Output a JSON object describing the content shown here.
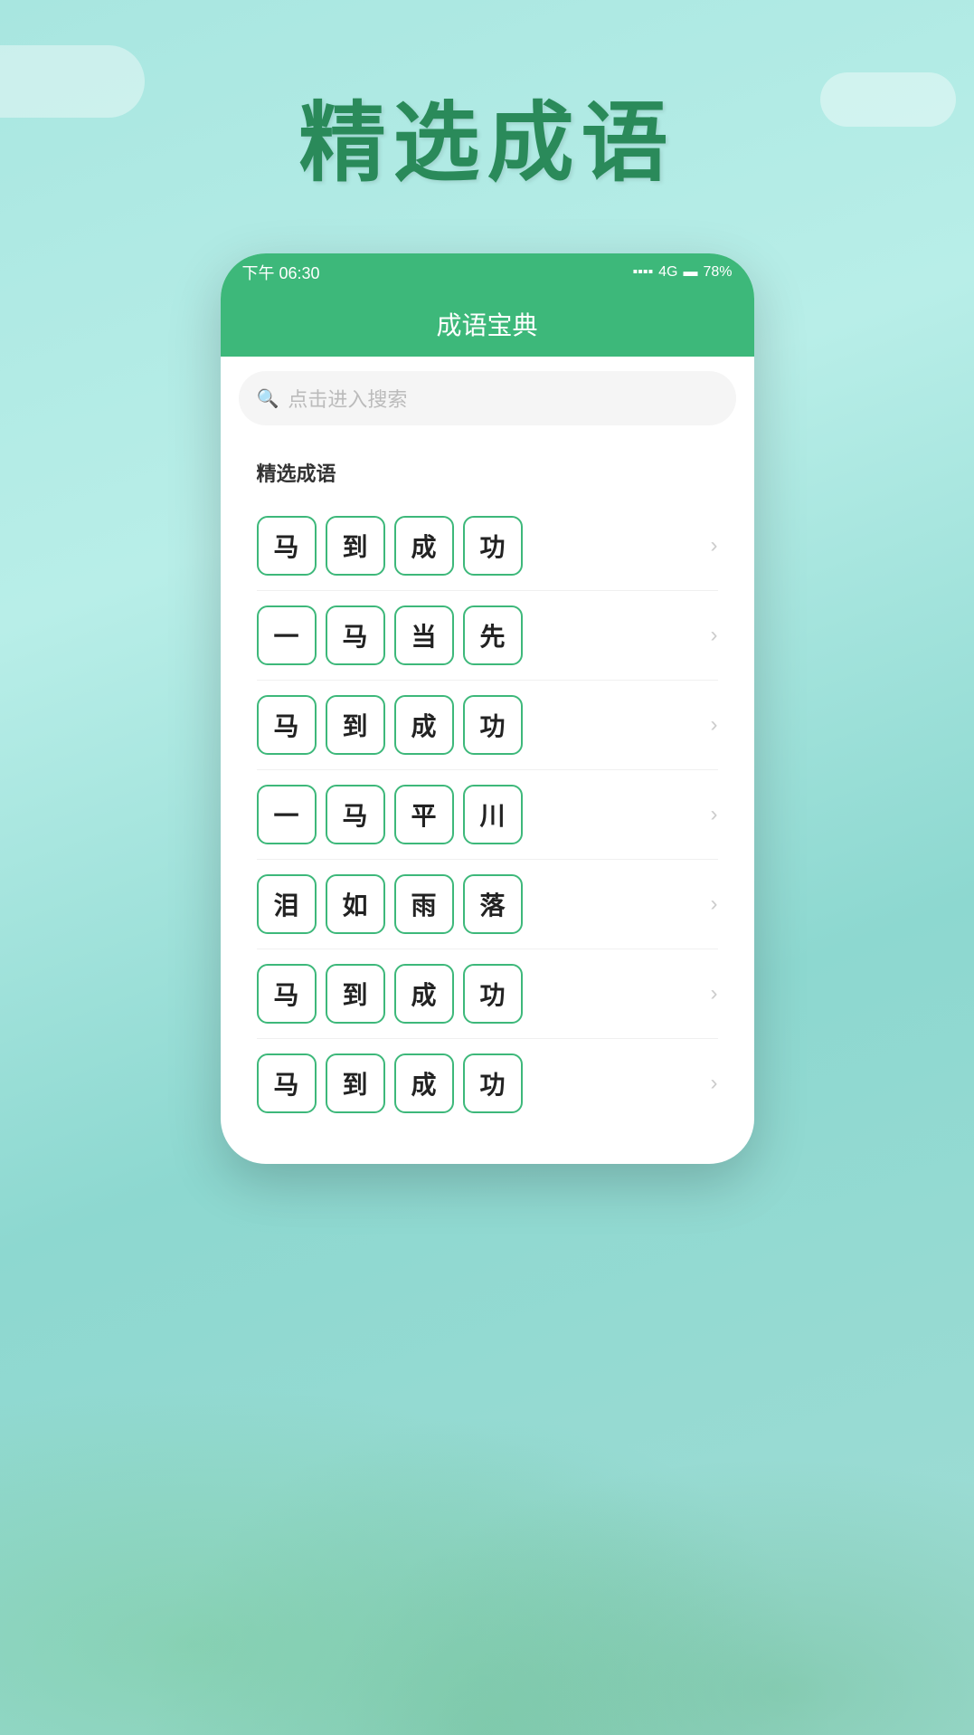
{
  "page": {
    "title": "精选成语",
    "background_color": "#a8e6e0"
  },
  "status_bar": {
    "time": "下午 06:30",
    "signal": "4G",
    "battery": "78%"
  },
  "app": {
    "header_title": "成语宝典"
  },
  "search": {
    "placeholder": "点击进入搜索"
  },
  "section": {
    "title": "精选成语"
  },
  "idioms": [
    {
      "chars": [
        "马",
        "到",
        "成",
        "功"
      ]
    },
    {
      "chars": [
        "一",
        "马",
        "当",
        "先"
      ]
    },
    {
      "chars": [
        "马",
        "到",
        "成",
        "功"
      ]
    },
    {
      "chars": [
        "一",
        "马",
        "平",
        "川"
      ]
    },
    {
      "chars": [
        "泪",
        "如",
        "雨",
        "落"
      ]
    },
    {
      "chars": [
        "马",
        "到",
        "成",
        "功"
      ]
    },
    {
      "chars": [
        "马",
        "到",
        "成",
        "功"
      ]
    }
  ],
  "icons": {
    "search": "🔍",
    "chevron": "›",
    "signal": "📶",
    "battery": "🔋"
  }
}
